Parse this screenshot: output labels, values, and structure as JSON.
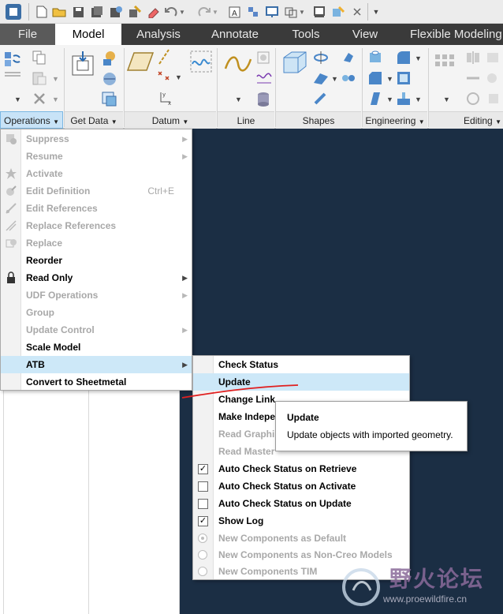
{
  "ribbon_tabs": [
    "File",
    "Model",
    "Analysis",
    "Annotate",
    "Tools",
    "View",
    "Flexible Modeling"
  ],
  "ribbon_groups": [
    "Operations",
    "Get Data",
    "Datum",
    "Line",
    "Shapes",
    "Engineering",
    "Editing"
  ],
  "operations_menu": {
    "items": [
      {
        "label": "Suppress",
        "enabled": false,
        "submenu": true
      },
      {
        "label": "Resume",
        "enabled": false,
        "submenu": true
      },
      {
        "label": "Activate",
        "enabled": false
      },
      {
        "label": "Edit Definition",
        "enabled": false,
        "shortcut": "Ctrl+E"
      },
      {
        "label": "Edit References",
        "enabled": false
      },
      {
        "label": "Replace References",
        "enabled": false
      },
      {
        "label": "Replace",
        "enabled": false
      },
      {
        "label": "Reorder",
        "enabled": true
      },
      {
        "label": "Read Only",
        "enabled": true,
        "submenu": true
      },
      {
        "label": "UDF Operations",
        "enabled": false,
        "submenu": true
      },
      {
        "label": "Group",
        "enabled": false
      },
      {
        "label": "Update Control",
        "enabled": false,
        "submenu": true
      },
      {
        "label": "Scale Model",
        "enabled": true
      },
      {
        "label": "ATB",
        "enabled": true,
        "submenu": true,
        "highlighted": true
      },
      {
        "label": "Convert to Sheetmetal",
        "enabled": true
      }
    ]
  },
  "atb_submenu": {
    "items": [
      {
        "label": "Check Status",
        "enabled": true
      },
      {
        "label": "Update",
        "enabled": true,
        "highlighted": true
      },
      {
        "label": "Change Link",
        "enabled": true
      },
      {
        "label": "Make Indepe",
        "enabled": true
      },
      {
        "label": "Read Graphi",
        "enabled": false
      },
      {
        "label": "Read Master",
        "enabled": false
      },
      {
        "label": "Auto Check Status on Retrieve",
        "enabled": true,
        "checkbox": true,
        "checked": true
      },
      {
        "label": "Auto Check Status on Activate",
        "enabled": true,
        "checkbox": true,
        "checked": false
      },
      {
        "label": "Auto Check Status on Update",
        "enabled": true,
        "checkbox": true,
        "checked": false
      },
      {
        "label": "Show Log",
        "enabled": true,
        "checkbox": true,
        "checked": true
      },
      {
        "label": "New Components as Default",
        "enabled": false,
        "radio": true,
        "checked": true
      },
      {
        "label": "New Components as Non-Creo Models",
        "enabled": false,
        "radio": true,
        "checked": false
      },
      {
        "label": "New Components TIM",
        "enabled": false,
        "radio": true,
        "checked": false
      }
    ]
  },
  "tooltip": {
    "title": "Update",
    "body": "Update objects with imported geometry."
  },
  "watermark": {
    "text": "野火论坛",
    "url": "www.proewildfire.cn"
  },
  "colors": {
    "accent": "#2f7fc1",
    "highlight": "#cde8f8",
    "canvas": "#1b2e44",
    "annotation": "#e02020"
  }
}
